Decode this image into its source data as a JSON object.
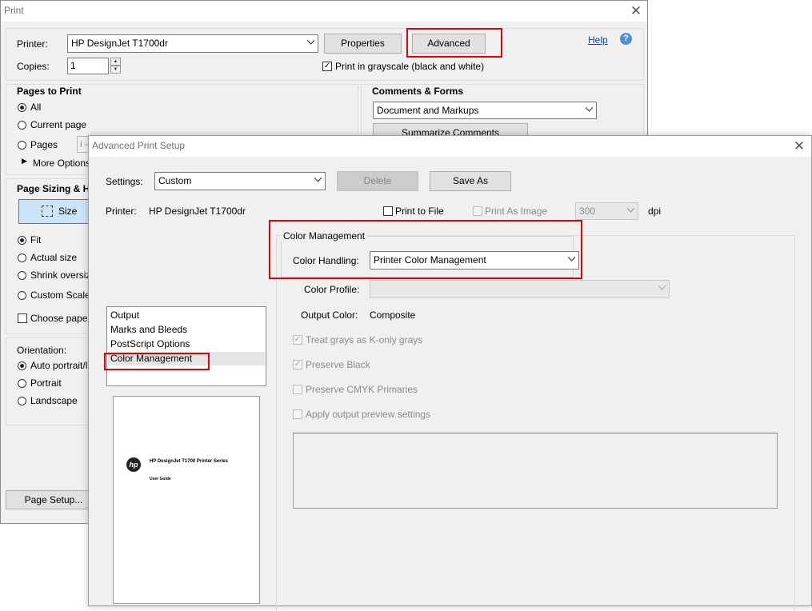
{
  "print_dialog": {
    "title": "Print",
    "printer_label": "Printer:",
    "printer_value": "HP DesignJet T1700dr",
    "properties_label": "Properties",
    "advanced_label": "Advanced",
    "help_label": "Help",
    "help_icon": "?",
    "copies_label": "Copies:",
    "copies_value": "1",
    "grayscale_label": "Print in grayscale (black and white)",
    "grayscale_checked": true,
    "pages_to_print": {
      "heading": "Pages to Print",
      "all": "All",
      "current_page": "Current page",
      "pages": "Pages",
      "pages_input_value": "i -",
      "more_options": "More Options"
    },
    "comments_forms": {
      "heading": "Comments & Forms",
      "value": "Document and Markups",
      "summarize_label": "Summarize Comments"
    },
    "page_sizing": {
      "heading": "Page Sizing & Ha",
      "size_label": "Size",
      "fit": "Fit",
      "actual_size": "Actual size",
      "shrink": "Shrink oversize",
      "custom_scale": "Custom Scale:",
      "choose_paper": "Choose paper"
    },
    "orientation": {
      "heading": "Orientation:",
      "auto": "Auto portrait/l",
      "portrait": "Portrait",
      "landscape": "Landscape"
    },
    "page_setup_label": "Page Setup..."
  },
  "advanced_dialog": {
    "title": "Advanced Print Setup",
    "settings_label": "Settings:",
    "settings_value": "Custom",
    "delete_label": "Delete",
    "save_as_label": "Save As",
    "printer_label": "Printer:",
    "printer_value": "HP DesignJet T1700dr",
    "print_to_file": "Print to File",
    "print_as_image": "Print As Image",
    "dpi_value": "300",
    "dpi_label": "dpi",
    "categories": [
      "Output",
      "Marks and Bleeds",
      "PostScript Options",
      "Color Management"
    ],
    "selected_category": "Color Management",
    "preview": {
      "logo_text": "hp",
      "doc_title": "HP DesignJet T1700 Printer Series",
      "doc_subtitle": "User Guide"
    },
    "color_management": {
      "group_title": "Color Management",
      "color_handling_label": "Color Handling:",
      "color_handling_value": "Printer Color Management",
      "color_profile_label": "Color Profile:",
      "output_color_label": "Output Color:",
      "output_color_value": "Composite",
      "treat_grays": "Treat grays as K-only grays",
      "treat_grays_checked": true,
      "preserve_black": "Preserve Black",
      "preserve_black_checked": true,
      "preserve_cmyk": "Preserve CMYK Primaries",
      "apply_preview": "Apply output preview settings"
    }
  },
  "colors": {
    "highlight_red": "#e0000b",
    "dialog_bg": "#f0f0f0",
    "link_blue": "#0645ad"
  }
}
